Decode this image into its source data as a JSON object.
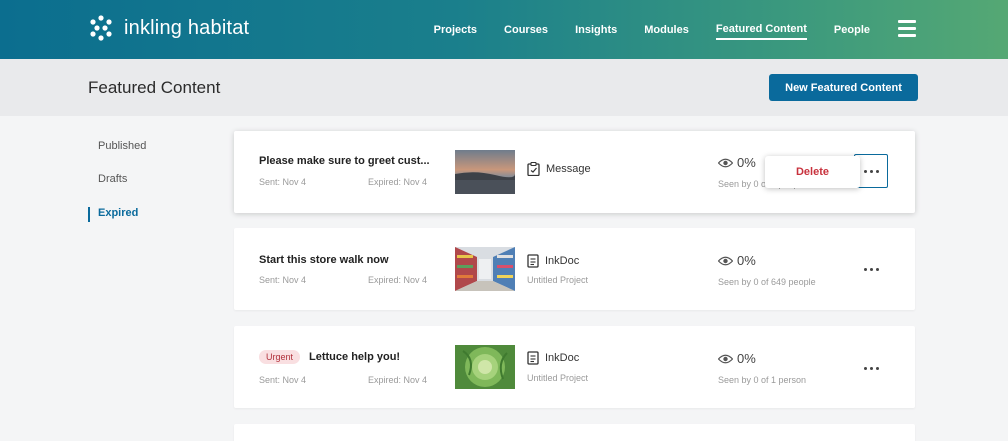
{
  "app": {
    "brand_name": "inkling habitat"
  },
  "nav": {
    "items": [
      {
        "label": "Projects"
      },
      {
        "label": "Courses"
      },
      {
        "label": "Insights"
      },
      {
        "label": "Modules"
      },
      {
        "label": "Featured Content",
        "active": true
      },
      {
        "label": "People"
      }
    ],
    "menu_icon": "hamburger-menu-icon"
  },
  "header": {
    "title": "Featured Content",
    "new_button_label": "New Featured Content"
  },
  "sidebar": {
    "items": [
      {
        "label": "Published"
      },
      {
        "label": "Drafts"
      },
      {
        "label": "Expired",
        "active": true
      }
    ]
  },
  "cards": [
    {
      "badge": "",
      "title": "Please make sure to greet cust...",
      "sent": "Sent: Nov 4",
      "expired": "Expired: Nov 4",
      "thumbnail": "sunset-water-image",
      "type_icon": "clipboard-icon",
      "type_label": "Message",
      "project": "",
      "percent": "0%",
      "seen": "Seen by 0 of 2 people"
    },
    {
      "badge": "",
      "title": "Start this store walk now",
      "sent": "Sent: Nov 4",
      "expired": "Expired: Nov 4",
      "thumbnail": "store-aisle-image",
      "type_icon": "document-icon",
      "type_label": "InkDoc",
      "project": "Untitled Project",
      "percent": "0%",
      "seen": "Seen by 0 of 649 people"
    },
    {
      "badge": "Urgent",
      "title": "Lettuce help you!",
      "sent": "Sent: Nov 4",
      "expired": "Expired: Nov 4",
      "thumbnail": "lettuce-image",
      "type_icon": "document-icon",
      "type_label": "InkDoc",
      "project": "Untitled Project",
      "percent": "0%",
      "seen": "Seen by 0 of 1 person"
    }
  ],
  "popover": {
    "delete_label": "Delete"
  },
  "colors": {
    "accent": "#0a6a9c",
    "danger": "#c8323d",
    "nav_gradient_start": "#0b6e8f",
    "nav_gradient_end": "#55a874"
  }
}
